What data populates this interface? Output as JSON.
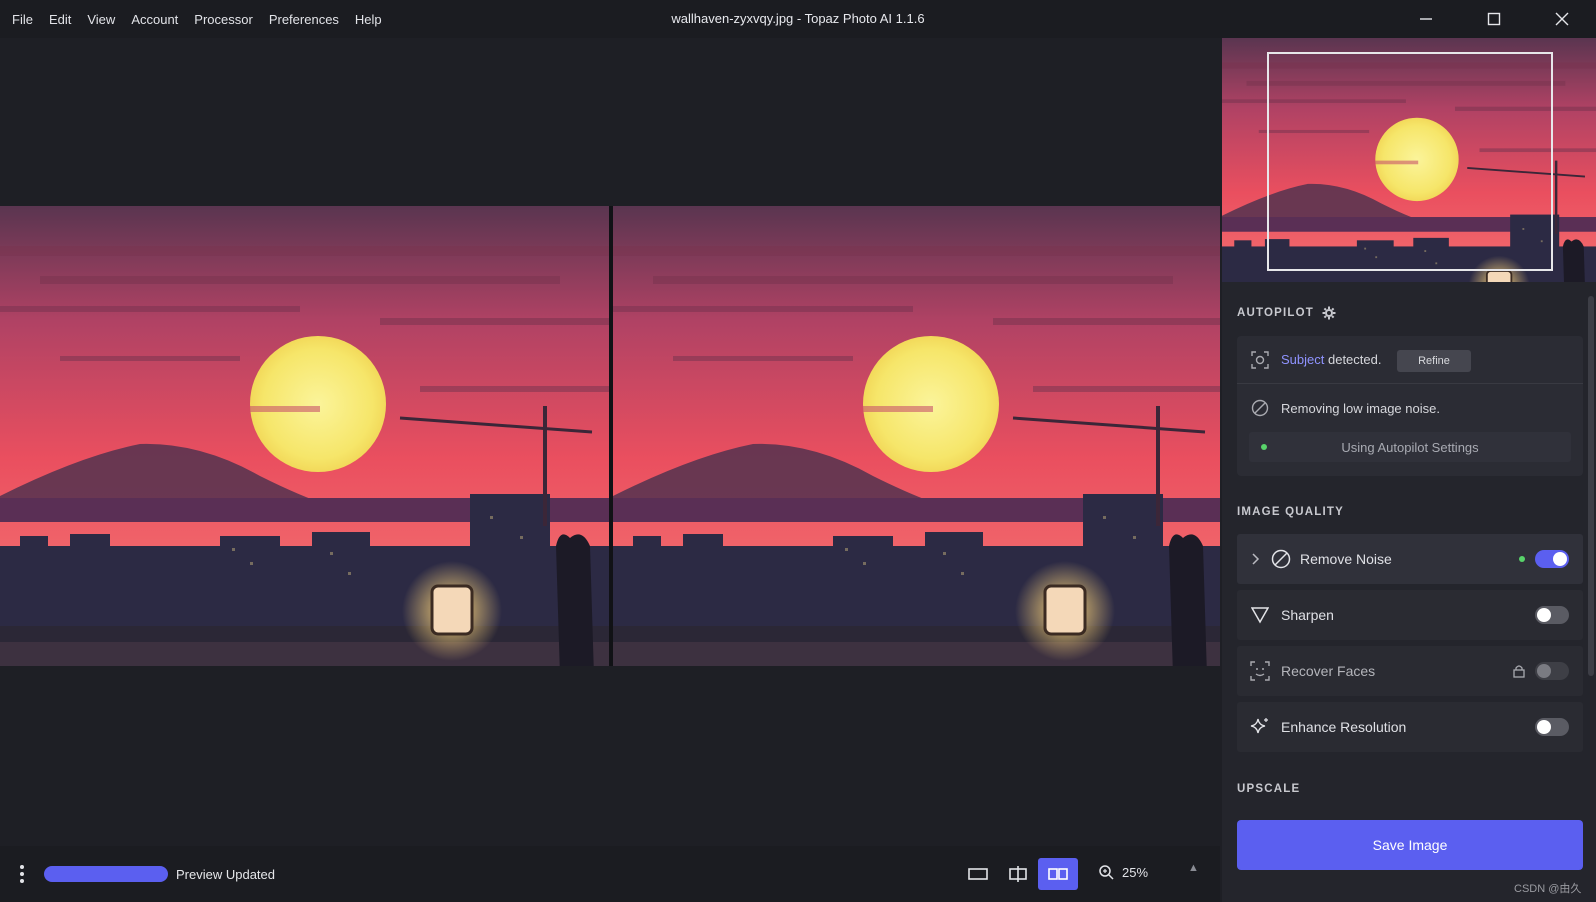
{
  "window": {
    "title": "wallhaven-zyxvqy.jpg - Topaz Photo AI 1.1.6",
    "menu": [
      "File",
      "Edit",
      "View",
      "Account",
      "Processor",
      "Preferences",
      "Help"
    ]
  },
  "bottom_bar": {
    "status": "Preview Updated",
    "zoom": "25%"
  },
  "panel": {
    "autopilot_title": "AUTOPILOT",
    "subject_word": "Subject",
    "subject_rest": " detected.",
    "refine_label": "Refine",
    "noise_message": "Removing low image noise.",
    "autopilot_settings": "Using Autopilot Settings",
    "image_quality_title": "IMAGE QUALITY",
    "filters": [
      {
        "label": "Remove Noise",
        "enabled": true
      },
      {
        "label": "Sharpen",
        "enabled": false
      },
      {
        "label": "Recover Faces",
        "enabled": false,
        "locked": true
      },
      {
        "label": "Enhance Resolution",
        "enabled": false
      }
    ],
    "upscale_title": "UPSCALE",
    "save_label": "Save Image"
  },
  "watermark": "CSDN @由久",
  "colors": {
    "accent": "#5b5ff0",
    "background": "#1e1f25",
    "panel": "#24252c",
    "status_dot": "#58d36a"
  }
}
